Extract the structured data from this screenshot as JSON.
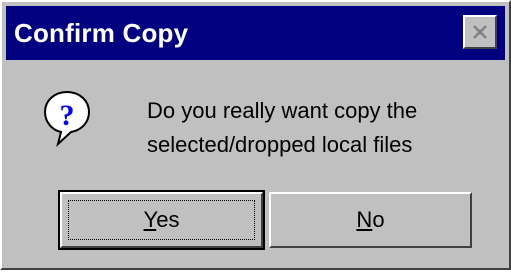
{
  "window": {
    "title": "Confirm Copy"
  },
  "message": {
    "line1": "Do you really want copy the",
    "line2": "selected/dropped local files"
  },
  "buttons": {
    "yes": {
      "mnemonic": "Y",
      "rest": "es"
    },
    "no": {
      "mnemonic": "N",
      "rest": "o"
    }
  },
  "icons": {
    "dialog": "question-icon",
    "close": "close-icon"
  },
  "colors": {
    "titlebar": "#000080",
    "face": "#c0c0c0",
    "question_mark": "#0000ff"
  }
}
